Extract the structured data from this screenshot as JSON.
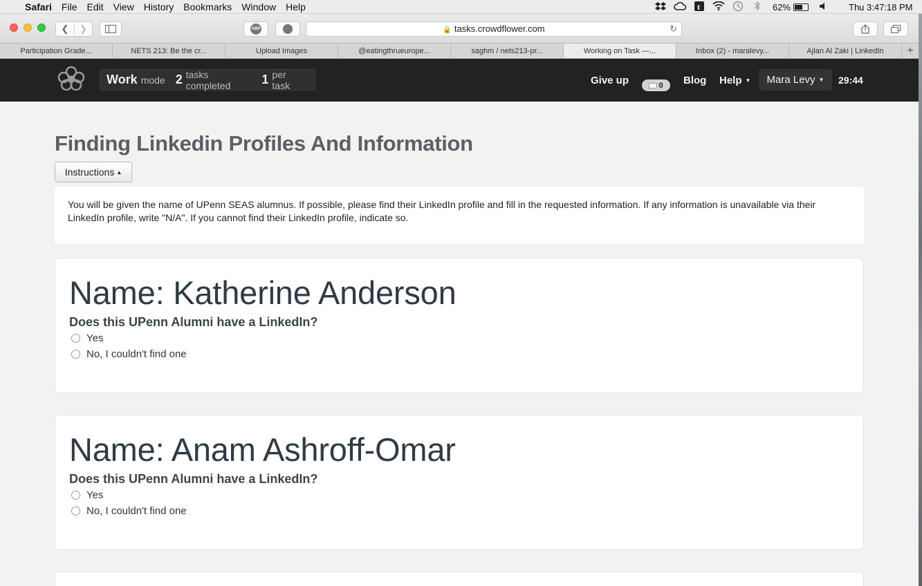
{
  "menubar": {
    "app": "Safari",
    "items": [
      "File",
      "Edit",
      "View",
      "History",
      "Bookmarks",
      "Window",
      "Help"
    ],
    "battery_percent": "62%",
    "battery_level": 0.62,
    "clock": "Thu 3:47:18 PM",
    "status_icons": [
      "dropbox-icon",
      "creative-cloud-icon",
      "tumblr-icon",
      "wifi-icon",
      "time-machine-icon",
      "bluetooth-icon"
    ]
  },
  "browser": {
    "url": "tasks.crowdflower.com",
    "abp_label": "ABP",
    "tabs": [
      {
        "label": "Participation Grade..."
      },
      {
        "label": "NETS 213: Be the cr..."
      },
      {
        "label": "Upload Images"
      },
      {
        "label": "@eatingthrueurope..."
      },
      {
        "label": "saghm / nets213-pr..."
      },
      {
        "label": "Working on Task —..."
      },
      {
        "label": "Inbox (2) - maralevy..."
      },
      {
        "label": "Ajlan Al Zaki | LinkedIn"
      }
    ],
    "active_tab": 5
  },
  "header": {
    "mode_word": "Work",
    "mode_label": "mode",
    "tasks_count": "2",
    "tasks_label": "tasks completed",
    "per_count": "1",
    "per_label": "per task",
    "give_up": "Give up",
    "messages_count": "0",
    "blog": "Blog",
    "help": "Help",
    "user": "Mara Levy",
    "timer": "29:44"
  },
  "page": {
    "title": "Finding Linkedin Profiles And Information",
    "instructions_button": "Instructions",
    "instructions_text": "You will be given the name of UPenn SEAS alumnus. If possible, please find their LinkedIn profile and fill in the requested information. If any information is unavailable via their LinkedIn profile, write \"N/A\". If you cannot find their LinkedIn profile, indicate so.",
    "cards": [
      {
        "name": "Name: Katherine Anderson",
        "question": "Does this UPenn Alumni have a LinkedIn?",
        "options": [
          "Yes",
          "No, I couldn't find one"
        ]
      },
      {
        "name": "Name: Anam Ashroff-Omar",
        "question": "Does this UPenn Alumni have a LinkedIn?",
        "options": [
          "Yes",
          "No, I couldn't find one"
        ]
      }
    ]
  }
}
